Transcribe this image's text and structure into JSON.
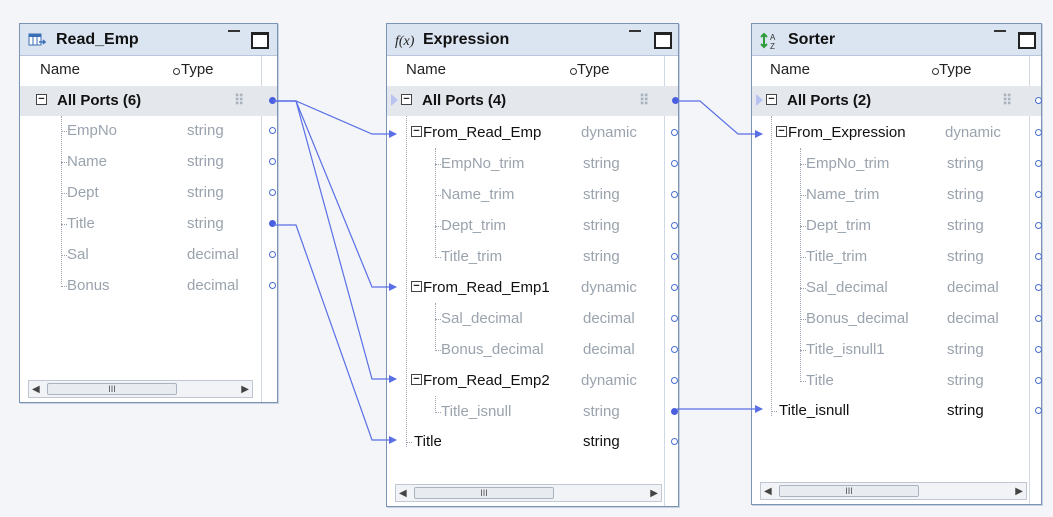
{
  "columns": {
    "name": "Name",
    "type": "Type"
  },
  "read_emp": {
    "title": "Read_Emp",
    "all_ports": "All Ports (6)",
    "fields": [
      {
        "name": "EmpNo",
        "type": "string"
      },
      {
        "name": "Name",
        "type": "string"
      },
      {
        "name": "Dept",
        "type": "string"
      },
      {
        "name": "Title",
        "type": "string"
      },
      {
        "name": "Sal",
        "type": "decimal"
      },
      {
        "name": "Bonus",
        "type": "decimal"
      }
    ]
  },
  "expression": {
    "title": "Expression",
    "icon_text": "f(x)",
    "all_ports": "All Ports (4)",
    "groups": [
      {
        "name": "From_Read_Emp",
        "type": "dynamic",
        "fields": [
          {
            "name": "EmpNo_trim",
            "type": "string"
          },
          {
            "name": "Name_trim",
            "type": "string"
          },
          {
            "name": "Dept_trim",
            "type": "string"
          },
          {
            "name": "Title_trim",
            "type": "string"
          }
        ]
      },
      {
        "name": "From_Read_Emp1",
        "type": "dynamic",
        "fields": [
          {
            "name": "Sal_decimal",
            "type": "decimal"
          },
          {
            "name": "Bonus_decimal",
            "type": "decimal"
          }
        ]
      },
      {
        "name": "From_Read_Emp2",
        "type": "dynamic",
        "fields": [
          {
            "name": "Title_isnull",
            "type": "string"
          }
        ]
      }
    ],
    "title_port": {
      "name": "Title",
      "type": "string"
    }
  },
  "sorter": {
    "title": "Sorter",
    "all_ports": "All Ports (2)",
    "group": {
      "name": "From_Expression",
      "type": "dynamic",
      "fields": [
        {
          "name": "EmpNo_trim",
          "type": "string"
        },
        {
          "name": "Name_trim",
          "type": "string"
        },
        {
          "name": "Dept_trim",
          "type": "string"
        },
        {
          "name": "Title_trim",
          "type": "string"
        },
        {
          "name": "Sal_decimal",
          "type": "decimal"
        },
        {
          "name": "Bonus_decimal",
          "type": "decimal"
        },
        {
          "name": "Title_isnull1",
          "type": "string"
        },
        {
          "name": "Title",
          "type": "string"
        }
      ]
    },
    "title_isnull_port": {
      "name": "Title_isnull",
      "type": "string"
    }
  },
  "scroll_glyph": "III",
  "colors": {
    "link": "#5a6fe6",
    "title_bar": "#dbe5f1",
    "group_row": "#e4e8ed"
  },
  "icons": {
    "read_emp": "table-source-icon",
    "expression": "function-icon",
    "sorter": "sort-icon"
  }
}
